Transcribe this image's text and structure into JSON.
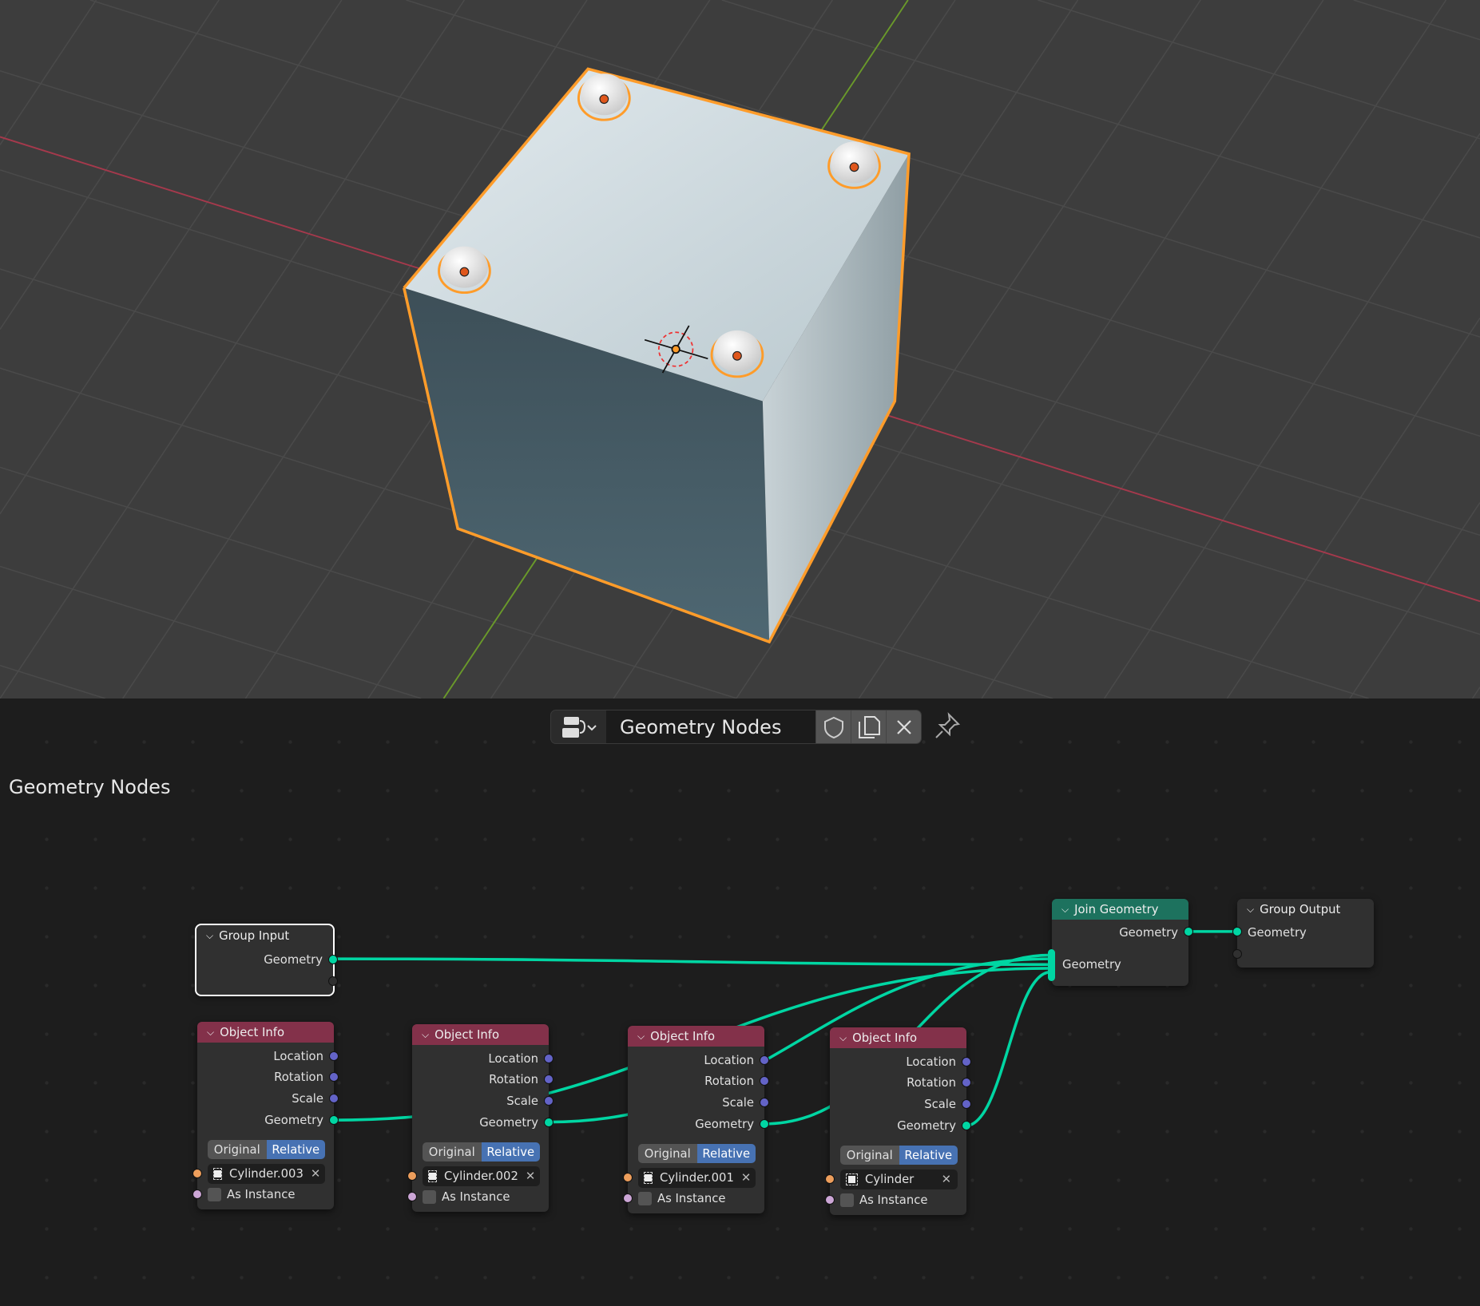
{
  "header": {
    "editor_type_icon": "node-editor-icon",
    "tree_name": "Geometry Nodes",
    "fake_user_icon": "shield-icon",
    "duplicate_icon": "duplicate-icon",
    "unlink_icon": "close-icon",
    "pin_icon": "pin-icon"
  },
  "editor_title": "Geometry Nodes",
  "colors": {
    "selection": "#ff9c2a",
    "geometry_socket": "#00d6a3",
    "vector_socket": "#6363c7",
    "object_socket": "#ed9e5c",
    "bool_socket": "#cca6d6",
    "object_info_header": "#83314a",
    "join_header": "#1d725e",
    "relative_active": "#4772b3"
  },
  "nodes": {
    "group_input": {
      "title": "Group Input",
      "outputs": [
        "Geometry"
      ]
    },
    "object_info": [
      {
        "title": "Object Info",
        "outputs": [
          "Location",
          "Rotation",
          "Scale",
          "Geometry"
        ],
        "mode": [
          "Original",
          "Relative"
        ],
        "mode_selected": "Relative",
        "object": "Cylinder.003",
        "as_instance": "As Instance"
      },
      {
        "title": "Object Info",
        "outputs": [
          "Location",
          "Rotation",
          "Scale",
          "Geometry"
        ],
        "mode": [
          "Original",
          "Relative"
        ],
        "mode_selected": "Relative",
        "object": "Cylinder.002",
        "as_instance": "As Instance"
      },
      {
        "title": "Object Info",
        "outputs": [
          "Location",
          "Rotation",
          "Scale",
          "Geometry"
        ],
        "mode": [
          "Original",
          "Relative"
        ],
        "mode_selected": "Relative",
        "object": "Cylinder.001",
        "as_instance": "As Instance"
      },
      {
        "title": "Object Info",
        "outputs": [
          "Location",
          "Rotation",
          "Scale",
          "Geometry"
        ],
        "mode": [
          "Original",
          "Relative"
        ],
        "mode_selected": "Relative",
        "object": "Cylinder",
        "as_instance": "As Instance"
      }
    ],
    "join_geometry": {
      "title": "Join Geometry",
      "output": "Geometry",
      "input": "Geometry"
    },
    "group_output": {
      "title": "Group Output",
      "input": "Geometry"
    }
  }
}
